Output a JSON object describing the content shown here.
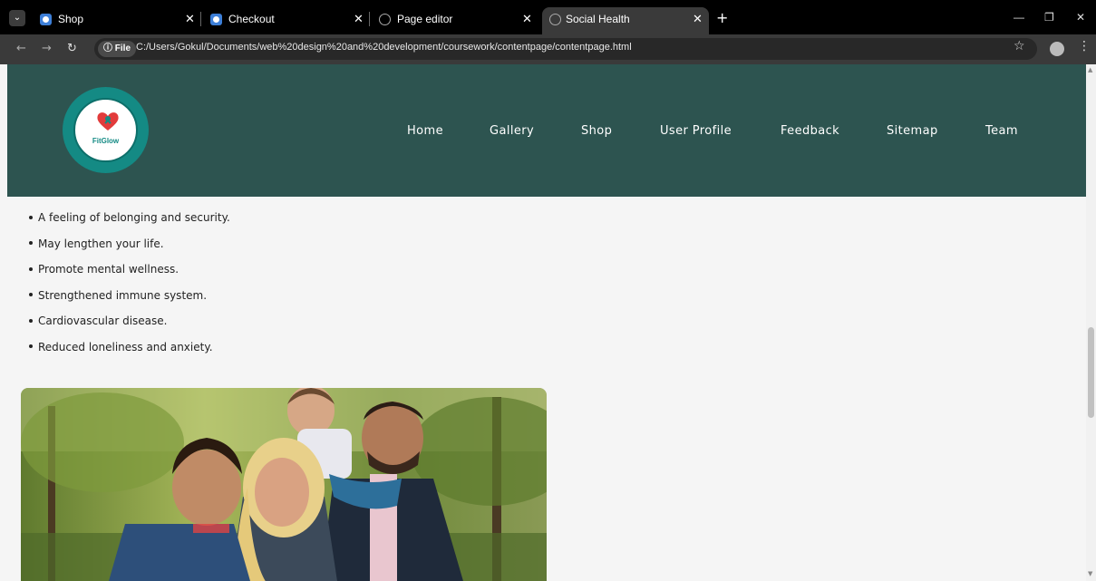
{
  "browser": {
    "tabs": [
      {
        "title": "Shop",
        "icon": "app-icon"
      },
      {
        "title": "Checkout",
        "icon": "app-icon"
      },
      {
        "title": "Page editor",
        "icon": "globe-icon"
      },
      {
        "title": "Social Health",
        "icon": "globe-icon",
        "active": true
      }
    ],
    "address": {
      "scheme_label": "File",
      "url": "C:/Users/Gokul/Documents/web%20design%20and%20development/coursework/contentpage/contentpage.html"
    }
  },
  "site": {
    "logo": {
      "text": "FitGlow",
      "colors": {
        "teal": "#148a84",
        "red": "#e23b3b"
      }
    },
    "nav": [
      "Home",
      "Gallery",
      "Shop",
      "User Profile",
      "Feedback",
      "Sitemap",
      "Team"
    ],
    "header_color": "#2d5450"
  },
  "content": {
    "benefits": [
      "A feeling of belonging and security.",
      "May lengthen your life.",
      "Promote mental wellness.",
      "Strengthened immune system.",
      "Cardiovascular disease.",
      "Reduced loneliness and anxiety."
    ],
    "photo": {
      "subject": "family-photo"
    }
  }
}
